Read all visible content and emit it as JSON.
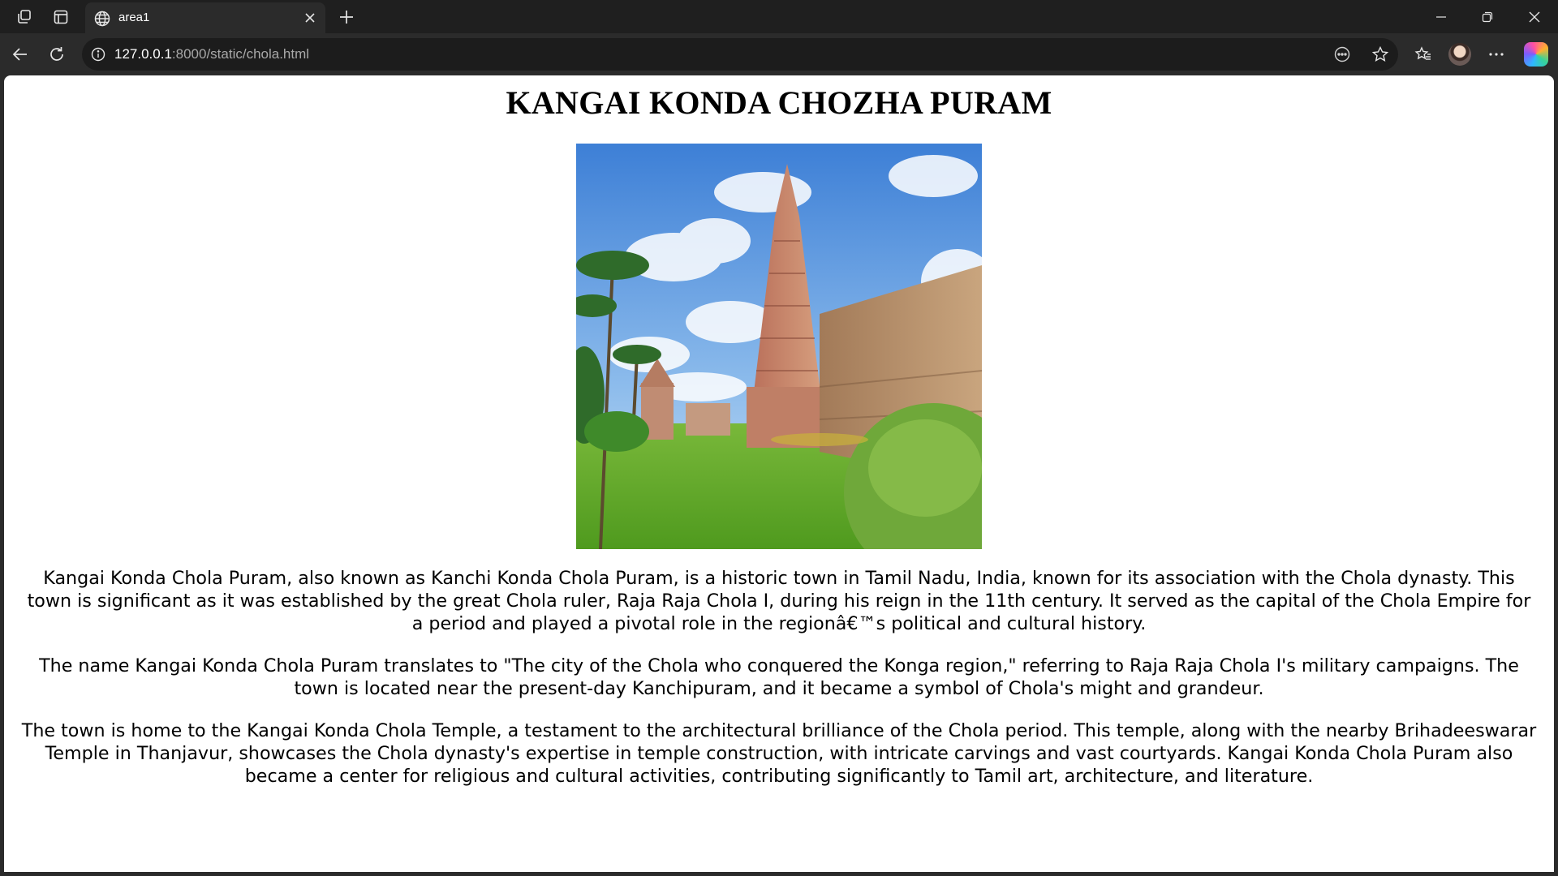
{
  "browser": {
    "tab_title": "area1",
    "url_host": "127.0.0.1",
    "url_path": ":8000/static/chola.html",
    "icons": [
      "workspaces-icon",
      "vertical-tabs-icon",
      "globe-icon",
      "tab-close-icon",
      "new-tab-icon",
      "minimize-icon",
      "restore-icon",
      "window-close-icon",
      "back-icon",
      "reload-icon",
      "site-info-icon",
      "read-aloud-icon",
      "favorite-star-icon",
      "favorites-icon",
      "profile-avatar",
      "more-menu-icon",
      "copilot-icon"
    ]
  },
  "page": {
    "title": "KANGAI KONDA CHOZHA PURAM",
    "paragraphs": [
      "Kangai Konda Chola Puram, also known as Kanchi Konda Chola Puram, is a historic town in Tamil Nadu, India, known for its association with the Chola dynasty. This town is significant as it was established by the great Chola ruler, Raja Raja Chola I, during his reign in the 11th century. It served as the capital of the Chola Empire for a period and played a pivotal role in the regionâ€™s political and cultural history.",
      "The name Kangai Konda Chola Puram translates to \"The city of the Chola who conquered the Konga region,\" referring to Raja Raja Chola I's military campaigns. The town is located near the present-day Kanchipuram, and it became a symbol of Chola's might and grandeur.",
      "The town is home to the Kangai Konda Chola Temple, a testament to the architectural brilliance of the Chola period. This temple, along with the nearby Brihadeeswarar Temple in Thanjavur, showcases the Chola dynasty's expertise in temple construction, with intricate carvings and vast courtyards. Kangai Konda Chola Puram also became a center for religious and cultural activities, contributing significantly to Tamil art, architecture, and literature."
    ]
  },
  "colors": {
    "tabstrip_bg": "#1f1f1f",
    "toolbar_bg": "#2b2b2b",
    "omnibox_bg": "#1c1c1c",
    "page_bg": "#ffffff",
    "text": "#000000"
  }
}
